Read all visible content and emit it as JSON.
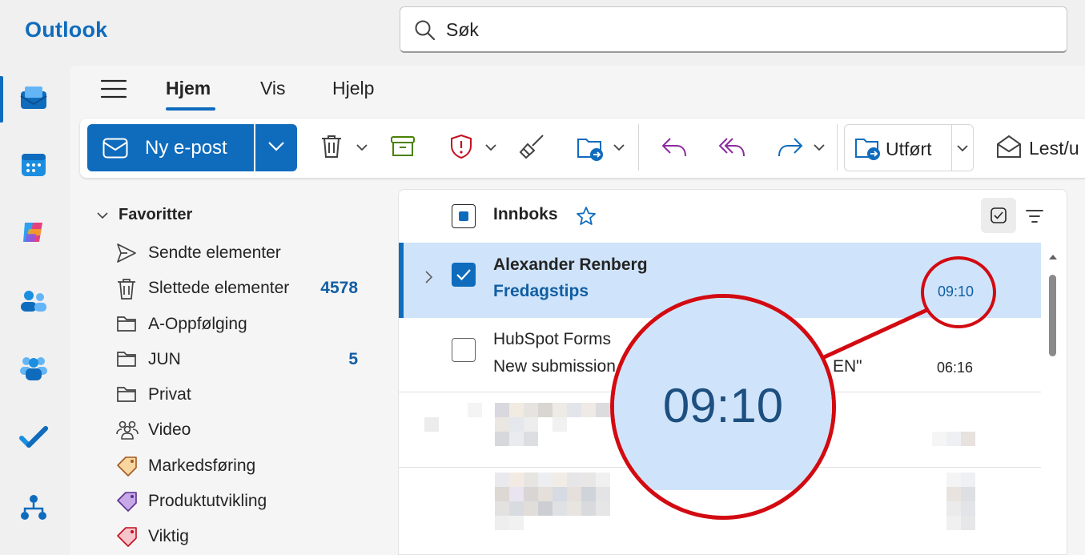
{
  "app": {
    "title": "Outlook"
  },
  "search": {
    "placeholder": "Søk"
  },
  "rail": {
    "items": [
      {
        "name": "mail-icon"
      },
      {
        "name": "calendar-icon"
      },
      {
        "name": "copilot-icon"
      },
      {
        "name": "people-icon"
      },
      {
        "name": "teams-icon"
      },
      {
        "name": "todo-icon"
      },
      {
        "name": "org-icon"
      }
    ]
  },
  "tabs": [
    {
      "label": "Hjem",
      "active": true
    },
    {
      "label": "Vis",
      "active": false
    },
    {
      "label": "Hjelp",
      "active": false
    }
  ],
  "ribbon": {
    "new_mail": "Ny e-post",
    "done": "Utført",
    "read_unread": "Lest/u"
  },
  "favorites": {
    "header": "Favoritter",
    "folders": [
      {
        "label": "Sendte elementer",
        "icon": "send-icon",
        "count": ""
      },
      {
        "label": "Slettede elementer",
        "icon": "trash-icon",
        "count": "4578"
      },
      {
        "label": "A-Oppfølging",
        "icon": "folder-icon",
        "count": ""
      },
      {
        "label": "JUN",
        "icon": "folder-icon",
        "count": "5"
      },
      {
        "label": "Privat",
        "icon": "folder-icon",
        "count": ""
      },
      {
        "label": "Video",
        "icon": "group-icon",
        "count": ""
      },
      {
        "label": "Markedsføring",
        "icon": "tag-icon",
        "count": ""
      },
      {
        "label": "Produktutvikling",
        "icon": "tag-icon",
        "count": ""
      },
      {
        "label": "Viktig",
        "icon": "tag-icon",
        "count": ""
      }
    ]
  },
  "inbox": {
    "title": "Innboks",
    "messages": [
      {
        "sender": "Alexander Renberg",
        "subject": "Fredagstips",
        "time": "09:10",
        "selected": true
      },
      {
        "sender": "HubSpot Forms",
        "subject": "New submission",
        "subject_tail": "EN\"",
        "time": "06:16",
        "selected": false
      }
    ]
  },
  "magnifier": {
    "text": "09:10"
  },
  "colors": {
    "accent": "#0f6cbd",
    "selected_row": "#cfe4fa",
    "highlight_ring": "#d20a11"
  }
}
